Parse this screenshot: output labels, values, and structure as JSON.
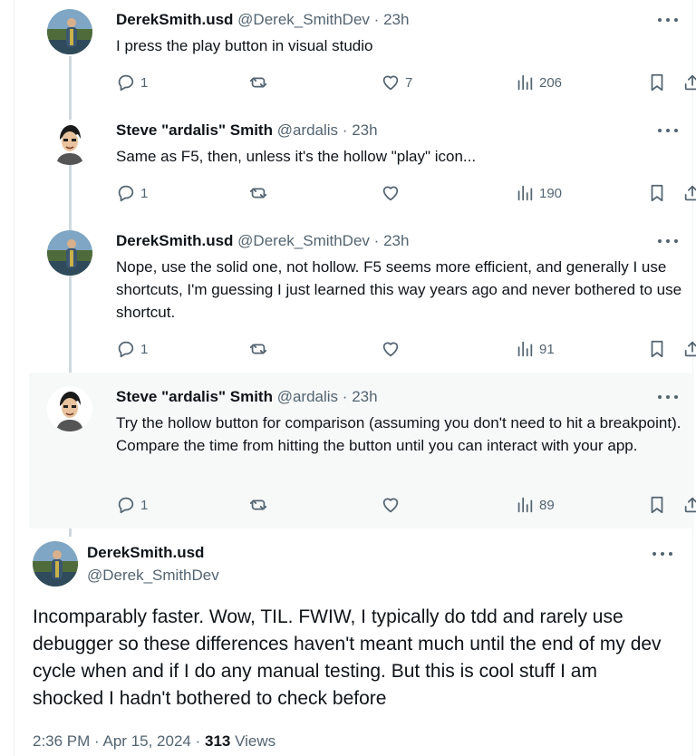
{
  "replies": [
    {
      "author_name": "DerekSmith.usd",
      "handle": "@Derek_SmithDev",
      "separator": "·",
      "time": "23h",
      "text": "I press the play button in visual studio",
      "replies_count": "1",
      "reposts_count": "",
      "likes_count": "7",
      "views_count": "206",
      "avatar": "derek-avatar"
    },
    {
      "author_name": "Steve \"ardalis\" Smith",
      "handle": "@ardalis",
      "separator": "·",
      "time": "23h",
      "text": "Same as F5, then, unless it's the hollow \"play\" icon...",
      "replies_count": "1",
      "reposts_count": "",
      "likes_count": "",
      "views_count": "190",
      "avatar": "steve-avatar"
    },
    {
      "author_name": "DerekSmith.usd",
      "handle": "@Derek_SmithDev",
      "separator": "·",
      "time": "23h",
      "text": "Nope, use the solid one, not hollow. F5 seems more efficient, and generally I use shortcuts, I'm guessing I just learned this way years ago and never bothered to use shortcut.",
      "replies_count": "1",
      "reposts_count": "",
      "likes_count": "",
      "views_count": "91",
      "avatar": "derek-avatar"
    },
    {
      "author_name": "Steve \"ardalis\" Smith",
      "handle": "@ardalis",
      "separator": "·",
      "time": "23h",
      "text": "Try the hollow button for comparison (assuming you don't need to hit a breakpoint). Compare the time from hitting the button until you can interact with your app.",
      "replies_count": "1",
      "reposts_count": "",
      "likes_count": "",
      "views_count": "89",
      "avatar": "steve-avatar"
    }
  ],
  "main_tweet": {
    "author_name": "DerekSmith.usd",
    "handle": "@Derek_SmithDev",
    "text": "Incomparably faster. Wow, TIL. FWIW,  I typically do tdd and rarely use debugger so these differences haven't meant much until the end of my dev cycle when and if I do any manual testing. But this is cool stuff I am shocked I hadn't bothered to check before",
    "time": "2:36 PM",
    "date": "Apr 15, 2024",
    "separator": "·",
    "views_count": "313",
    "views_label": "Views"
  },
  "colors": {
    "text_primary": "#0f1419",
    "text_secondary": "#536471",
    "thread_line": "#cfd9de",
    "highlight_bg": "#f7f9f9"
  }
}
